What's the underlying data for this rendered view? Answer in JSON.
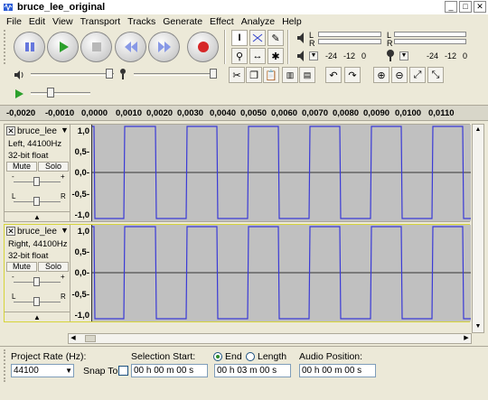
{
  "window": {
    "title": "bruce_lee_original"
  },
  "menu": [
    "File",
    "Edit",
    "View",
    "Transport",
    "Tracks",
    "Generate",
    "Effect",
    "Analyze",
    "Help"
  ],
  "meters": {
    "ticks": [
      "-24",
      "-12",
      "0"
    ],
    "left_label": "L",
    "right_label": "R"
  },
  "ruler": {
    "ticks": [
      "-0,0020",
      "-0,0010",
      "0,0000",
      "0,0010",
      "0,0020",
      "0,0030",
      "0,0040",
      "0,0050",
      "0,0060",
      "0,0070",
      "0,0080",
      "0,0090",
      "0,0100",
      "0,0110"
    ]
  },
  "tracks": [
    {
      "name": "bruce_lee",
      "info1": "Left, 44100Hz",
      "info2": "32-bit float",
      "mute": "Mute",
      "solo": "Solo",
      "gain_minus": "-",
      "gain_plus": "+",
      "pan_l": "L",
      "pan_r": "R",
      "scale": [
        "1,0",
        "0,5-",
        "0,0-",
        "-0,5-",
        "-1,0"
      ]
    },
    {
      "name": "bruce_lee",
      "info1": "Right, 44100Hz",
      "info2": "32-bit float",
      "mute": "Mute",
      "solo": "Solo",
      "gain_minus": "-",
      "gain_plus": "+",
      "pan_l": "L",
      "pan_r": "R",
      "scale": [
        "1,0",
        "0,5-",
        "0,0-",
        "-0,5-",
        "-1,0"
      ]
    }
  ],
  "bottom": {
    "project_rate_label": "Project Rate (Hz):",
    "project_rate_value": "44100",
    "snap_to_label": "Snap To",
    "selection_start_label": "Selection Start:",
    "selection_start_value": "00 h 00 m 00 s",
    "end_label": "End",
    "length_label": "Length",
    "end_value": "00 h 03 m 00 s",
    "audio_position_label": "Audio Position:",
    "audio_position_value": "00 h 00 m 00 s"
  },
  "colors": {
    "waveform": "#3a3ad6",
    "play": "#2ca02c",
    "record": "#d62728",
    "transport_blue": "#6677dd"
  }
}
